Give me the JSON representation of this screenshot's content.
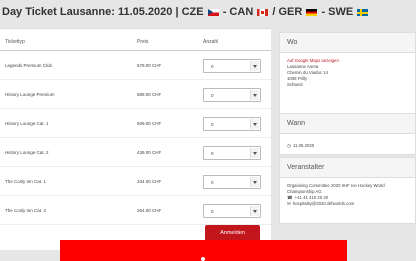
{
  "title": {
    "text": "Day Ticket Lausanne: 11.05.2020 | CZE",
    "sep1": " - CAN ",
    "sep2": " / GER ",
    "sep3": " - SWE "
  },
  "table": {
    "headers": {
      "type": "Tickettyp",
      "price": "Preis",
      "qty": "Anzahl"
    },
    "rows": [
      {
        "name": "Legends Premium Club",
        "price": "679.00 CHF",
        "qty": "0"
      },
      {
        "name": "History Lounge Premium",
        "price": "689.00 CHF",
        "qty": "0"
      },
      {
        "name": "History Lounge Cat. 1",
        "price": "509.00 CHF",
        "qty": "0"
      },
      {
        "name": "History Lounge Cat. 2",
        "price": "439.00 CHF",
        "qty": "0"
      },
      {
        "name": "The Cosly Inn Cat. 1",
        "price": "334.00 CHF",
        "qty": "0"
      },
      {
        "name": "The Cosly Inn Cat. 2",
        "price": "264.00 CHF",
        "qty": "0"
      }
    ]
  },
  "submit_label": "Anmelden",
  "sidebar": {
    "where": {
      "heading": "Wo",
      "map_link": "Auf Google Maps anzeigen",
      "lines": [
        "Lausanne Arena",
        "Chemin du Viaduc 14",
        "1008 Prilly",
        "Schweiz"
      ]
    },
    "when": {
      "heading": "Wann",
      "date": "11.05.2020"
    },
    "organizer": {
      "heading": "Veranstalter",
      "lines": [
        "Organising Committee 2020 IIHF Ice Hockey World",
        "Championship AG"
      ],
      "phone": "+41 41 410 20 20",
      "email": "hospitality@2020.iihfworlds.com"
    }
  },
  "colors": {
    "accent": "#c0161c",
    "overlay": "#ff0000"
  },
  "icons": [
    "clock-icon",
    "phone-icon",
    "mail-icon",
    "chevron-down-icon"
  ]
}
